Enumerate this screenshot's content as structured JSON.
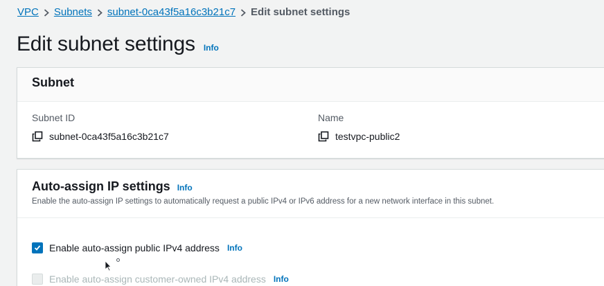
{
  "breadcrumb": {
    "items": [
      {
        "label": "VPC"
      },
      {
        "label": "Subnets"
      },
      {
        "label": "subnet-0ca43f5a16c3b21c7"
      }
    ],
    "current": "Edit subnet settings"
  },
  "page": {
    "title": "Edit subnet settings",
    "info": "Info"
  },
  "subnet_panel": {
    "heading": "Subnet",
    "subnet_id_label": "Subnet ID",
    "subnet_id_value": "subnet-0ca43f5a16c3b21c7",
    "name_label": "Name",
    "name_value": "testvpc-public2"
  },
  "auto_assign": {
    "heading": "Auto-assign IP settings",
    "info": "Info",
    "description": "Enable the auto-assign IP settings to automatically request a public IPv4 or IPv6 address for a new network interface in this subnet.",
    "options": [
      {
        "label": "Enable auto-assign public IPv4 address",
        "info": "Info",
        "checked": true,
        "disabled": false
      },
      {
        "label": "Enable auto-assign customer-owned IPv4 address",
        "info": "Info",
        "checked": false,
        "disabled": true
      }
    ]
  },
  "colors": {
    "link": "#0073bb",
    "checkbox_checked": "#0073bb",
    "background": "#f2f3f3"
  },
  "icons": [
    "chevron-right-icon",
    "copy-icon",
    "checkmark-icon",
    "mouse-pointer-icon"
  ]
}
